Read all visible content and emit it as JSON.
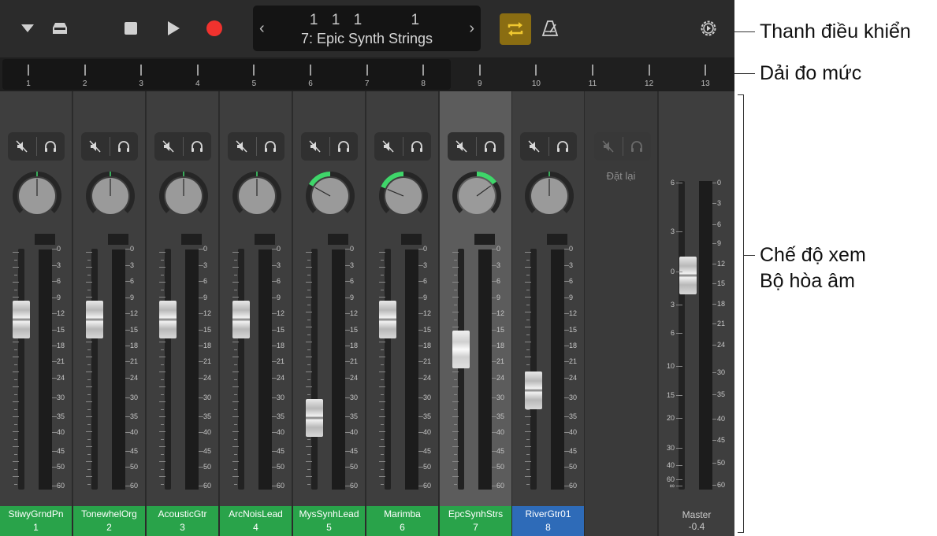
{
  "control_bar": {
    "lcd_position": "1 1 1     1",
    "lcd_track": "7: Epic Synth Strings",
    "icons": [
      "chevron-down-icon",
      "tray-icon",
      "stop-icon",
      "play-icon",
      "record-icon",
      "cycle-icon",
      "metronome-icon",
      "settings-icon"
    ],
    "cycle_color": "#8a6d12",
    "record_color": "#f0322e"
  },
  "meter_strip": {
    "labels": [
      "1",
      "2",
      "3",
      "4",
      "5",
      "6",
      "7",
      "8",
      "9",
      "10",
      "11",
      "12",
      "13"
    ]
  },
  "scale_labels": [
    "0",
    "3",
    "6",
    "9",
    "12",
    "15",
    "18",
    "21",
    "24",
    "30",
    "35",
    "40",
    "45",
    "50",
    "60"
  ],
  "channels": [
    {
      "name": "StiwyGrndPn",
      "number": "1",
      "color": "green",
      "pan": 0
    },
    {
      "name": "TonewhelOrg",
      "number": "2",
      "color": "green",
      "pan": 0
    },
    {
      "name": "AcousticGtr",
      "number": "3",
      "color": "green",
      "pan": 0
    },
    {
      "name": "ArcNoisLead",
      "number": "4",
      "color": "green",
      "pan": 0
    },
    {
      "name": "MysSynhLead",
      "number": "5",
      "color": "green",
      "pan": -0.45
    },
    {
      "name": "Marimba",
      "number": "6",
      "color": "green",
      "pan": -0.5
    },
    {
      "name": "EpcSynhStrs",
      "number": "7",
      "color": "green",
      "pan": 0.4,
      "selected": true
    },
    {
      "name": "RiverGtr01",
      "number": "8",
      "color": "blue",
      "pan": 0
    }
  ],
  "reset_label": "Đặt lại",
  "master": {
    "name": "Master",
    "value": "-0.4",
    "left_scale": [
      "6",
      "3",
      "0",
      "3",
      "6",
      "10",
      "15",
      "20",
      "30",
      "40",
      "60",
      "∞"
    ],
    "right_scale": [
      "0",
      "3",
      "6",
      "9",
      "12",
      "15",
      "18",
      "21",
      "24",
      "30",
      "35",
      "40",
      "45",
      "50",
      "60"
    ]
  },
  "callouts": {
    "control_bar": "Thanh điều khiển",
    "level_meter_strip": "Dải đo mức",
    "mixer_view_line1": "Chế độ xem",
    "mixer_view_line2": "Bộ hòa âm"
  },
  "colors": {
    "green": "#29a34a",
    "blue": "#2e6bb8",
    "pan_indicator": "#3fd66a"
  }
}
